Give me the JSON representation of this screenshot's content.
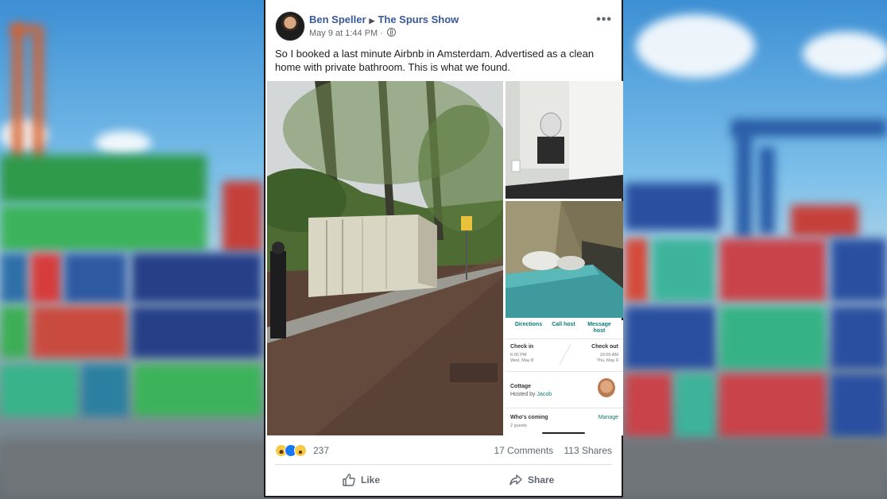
{
  "post": {
    "author": "Ben Speller",
    "target": "The Spurs Show",
    "date": "May 9 at 1:44 PM",
    "separator": "·",
    "text": "So I booked a last minute Airbnb in Amsterdam. Advertised as a clean home with private bathroom. This is what we found."
  },
  "icons": {
    "avatar": "profile-photo",
    "arrow": "triangle-right-icon",
    "privacy": "globe-icon",
    "more": "more-options-icon",
    "like": "thumbs-up-icon",
    "share": "share-arrow-icon"
  },
  "booking": {
    "directions": "Directions",
    "call_host": "Call host",
    "message_host_line1": "Message",
    "message_host_line2": "host",
    "check_in_label": "Check in",
    "check_in_time": "6:00 PM",
    "check_in_date": "Wed, May 8",
    "check_out_label": "Check out",
    "check_out_time": "10:00 AM",
    "check_out_date": "Thu, May 9",
    "listing_type": "Cottage",
    "hosted_by_prefix": "Hosted by",
    "host_name": "Jacob",
    "whos_coming": "Who's coming",
    "manage": "Manage",
    "guests": "2 guests"
  },
  "reactions": {
    "count": "237",
    "comments": "17 Comments",
    "shares": "113 Shares"
  },
  "actions": {
    "like": "Like",
    "share": "Share"
  },
  "colors": {
    "link": "#385898",
    "secondary_text": "#606770",
    "airbnb_teal": "#0b7a75"
  }
}
